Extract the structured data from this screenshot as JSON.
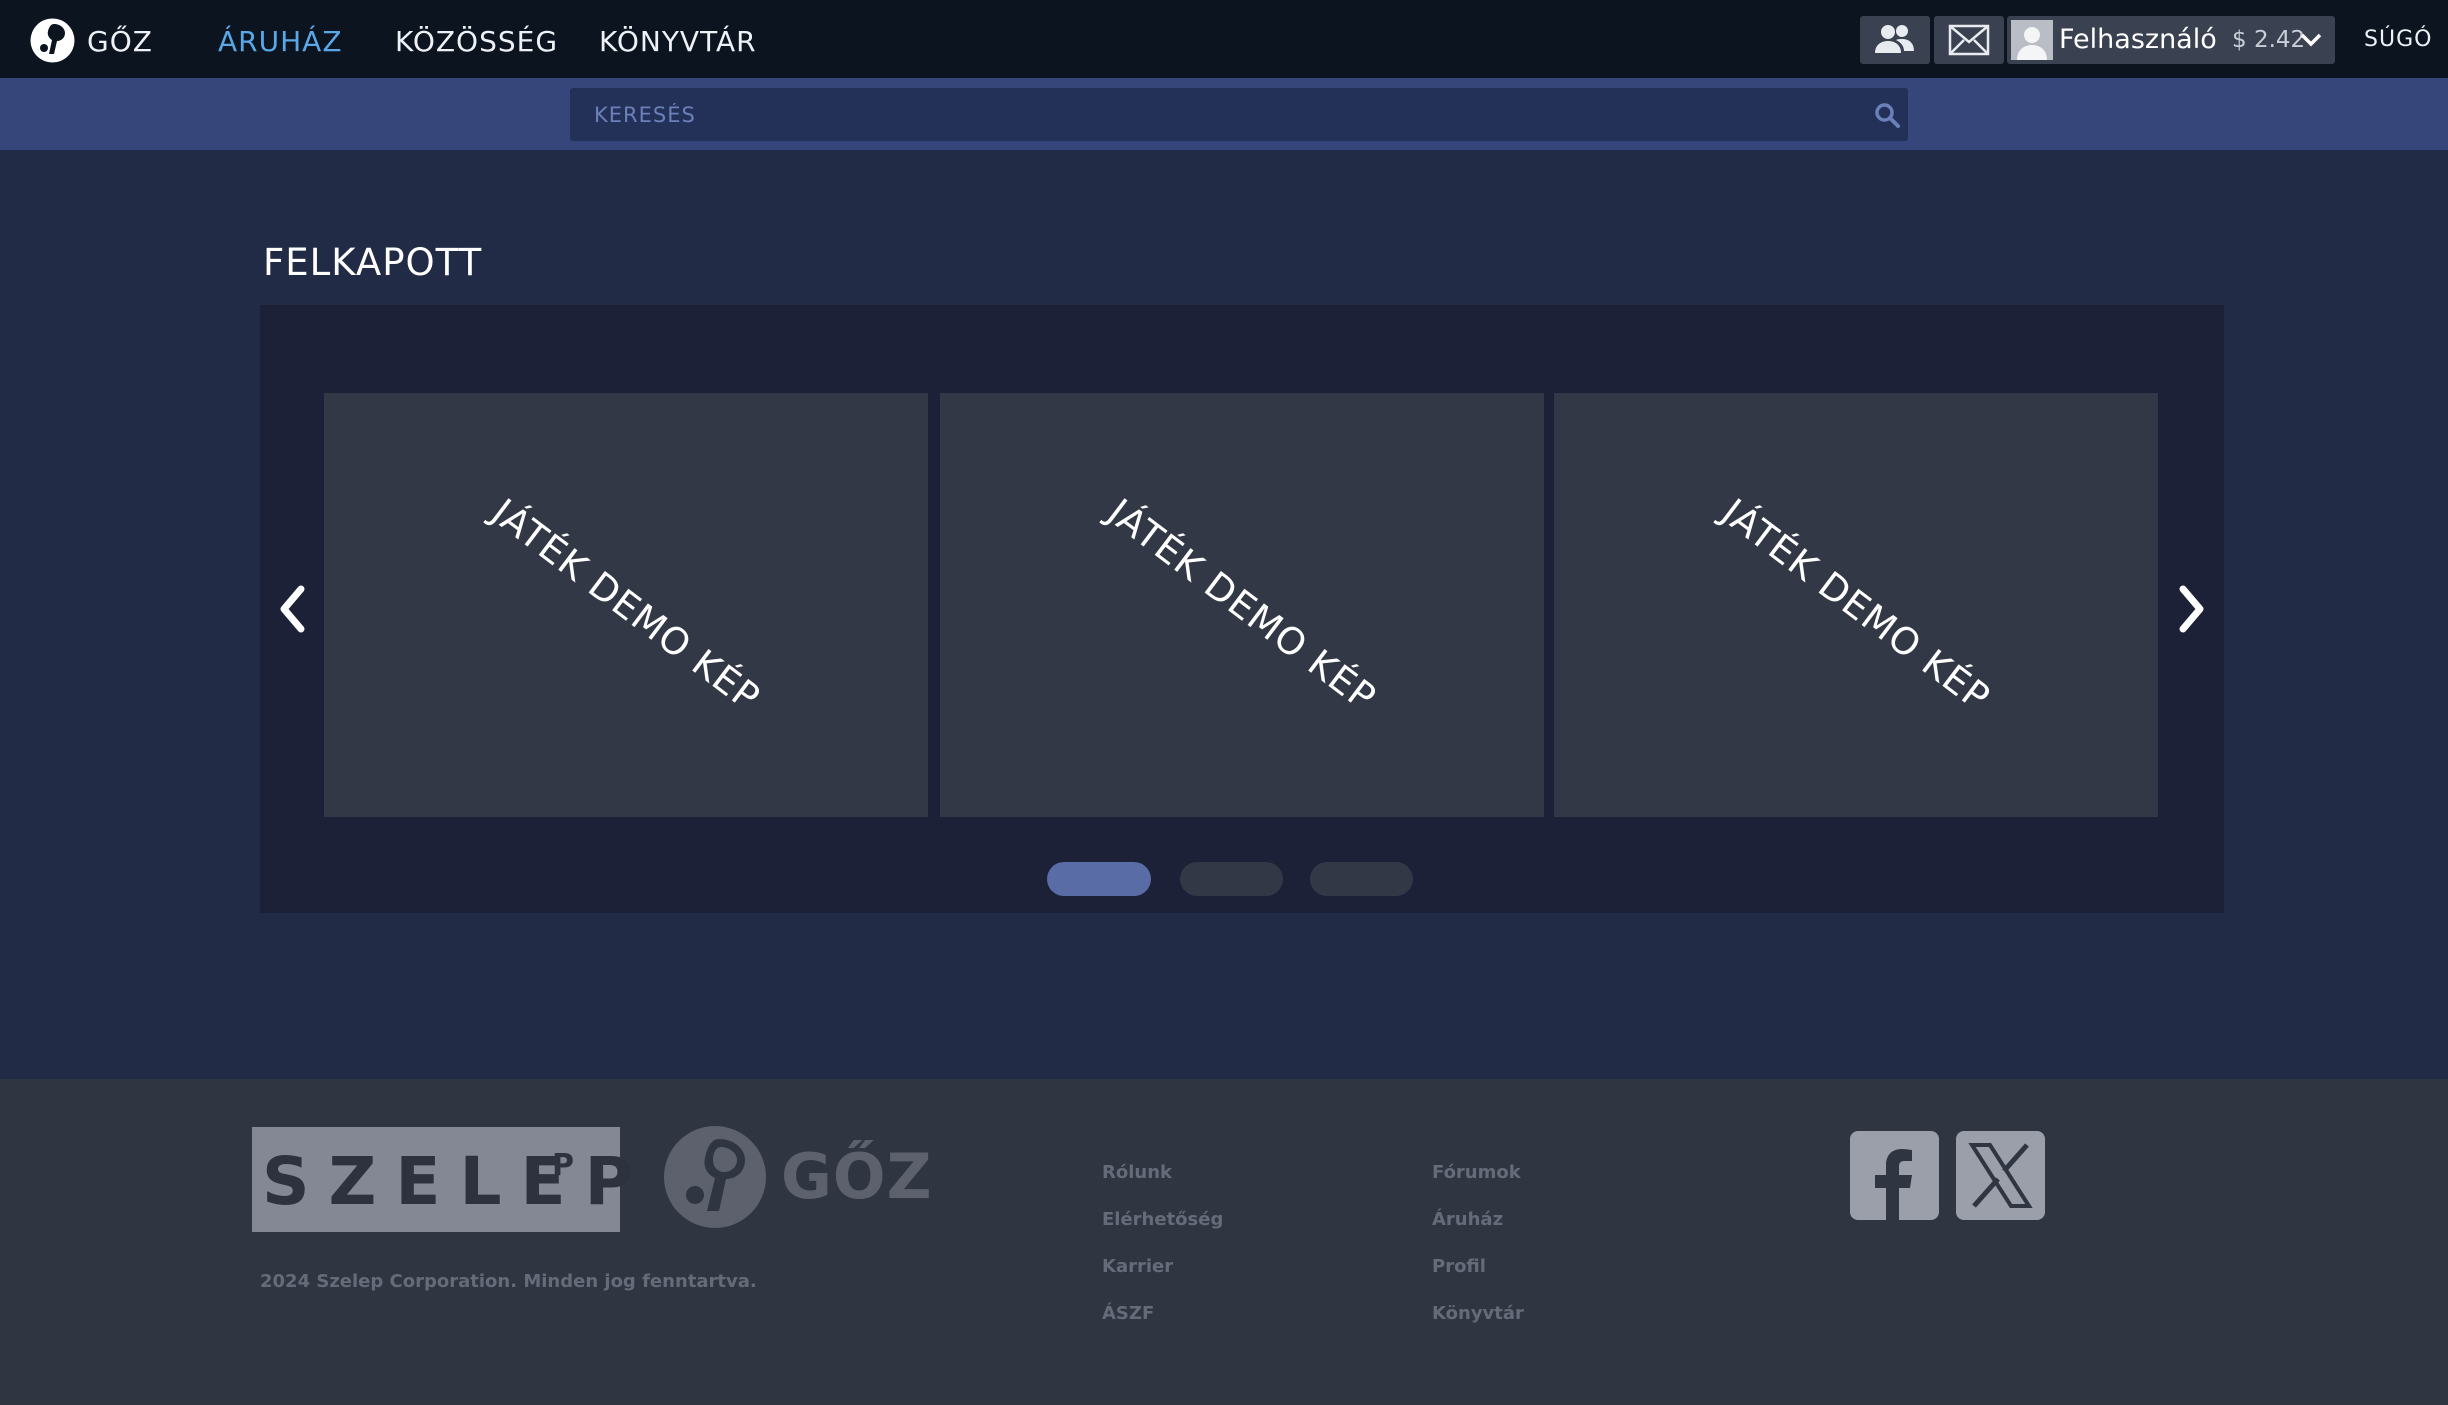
{
  "header": {
    "brand": "GŐZ",
    "nav": [
      {
        "label": "ÁRUHÁZ",
        "active": true
      },
      {
        "label": "KÖZÖSSÉG",
        "active": false
      },
      {
        "label": "KÖNYVTÁR",
        "active": false
      }
    ],
    "icons": {
      "logo": "steam-logo-icon",
      "friends": "friends-icon",
      "mail": "mail-icon",
      "chevron": "chevron-down-icon"
    },
    "account": {
      "username": "Felhasználó",
      "balance": "$ 2.42"
    },
    "help": "SÚGÓ"
  },
  "search": {
    "placeholder": "KERESÉS",
    "value": "",
    "icon": "search-icon"
  },
  "main": {
    "title": "FELKAPOTT",
    "slides": [
      {
        "label": "JÁTÉK DEMO KÉP"
      },
      {
        "label": "JÁTÉK DEMO KÉP"
      },
      {
        "label": "JÁTÉK DEMO KÉP"
      }
    ],
    "active_slide": 0,
    "slide_count": 3
  },
  "footer": {
    "company_logo": "SZELEP",
    "company_logo_sup": "P",
    "brand_logo": "GŐZ",
    "copyright": "2024 Szelep Corporation. Minden jog fenntartva.",
    "links_col1": [
      "Rólunk",
      "Elérhetőség",
      "Karrier",
      "ÁSZF"
    ],
    "links_col2": [
      "Fórumok",
      "Áruház",
      "Profil",
      "Könyvtár"
    ],
    "social": [
      "facebook-icon",
      "x-icon"
    ]
  },
  "colors": {
    "topbar": "#0c141f",
    "accent_nav": "#5aa7e8",
    "search_band": "#36467a",
    "page_bg": "#222b45",
    "carousel_bg": "#1c2137",
    "slide_bg": "#323845",
    "active_dot": "#5a6ca6",
    "footer_bg": "#303542"
  }
}
